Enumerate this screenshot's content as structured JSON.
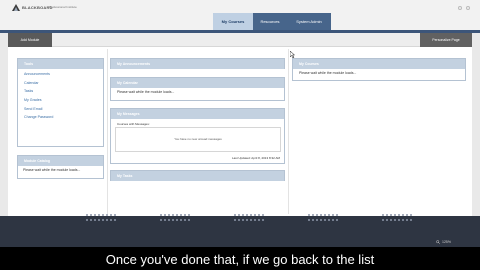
{
  "header": {
    "logo_text": "BLACKBOARD",
    "logo_subtext": "Professional Institute",
    "tabs": [
      {
        "label": "My Courses",
        "active": true
      },
      {
        "label": "Resources",
        "active": false
      },
      {
        "label": "System Admin",
        "active": false
      }
    ]
  },
  "toolbar": {
    "add_module_label": "Add Module",
    "personalize_label": "Personalize Page"
  },
  "modules": {
    "tools": {
      "title": "Tools",
      "items": [
        "Announcements",
        "Calendar",
        "Tasks",
        "My Grades",
        "Send Email",
        "Change Password"
      ]
    },
    "module_catalog": {
      "title": "Module Catalog",
      "loading_text": "Please wait while the module loads..."
    },
    "announcements": {
      "title": "My Announcements"
    },
    "calendar": {
      "title": "My Calendar",
      "loading_text": "Please wait while the module loads..."
    },
    "messages": {
      "title": "My Messages",
      "section_label": "Courses with Messages:",
      "empty_text": "You have no new unread messages",
      "last_updated": "Last Updated: April 8, 2013 8:32 AM"
    },
    "tasks": {
      "title": "My Tasks"
    },
    "courses": {
      "title": "My Courses",
      "loading_text": "Please wait while the module loads..."
    }
  },
  "status_bar": {
    "zoom": "125%"
  },
  "subtitle": "Once you've done that, if we go back to the list"
}
